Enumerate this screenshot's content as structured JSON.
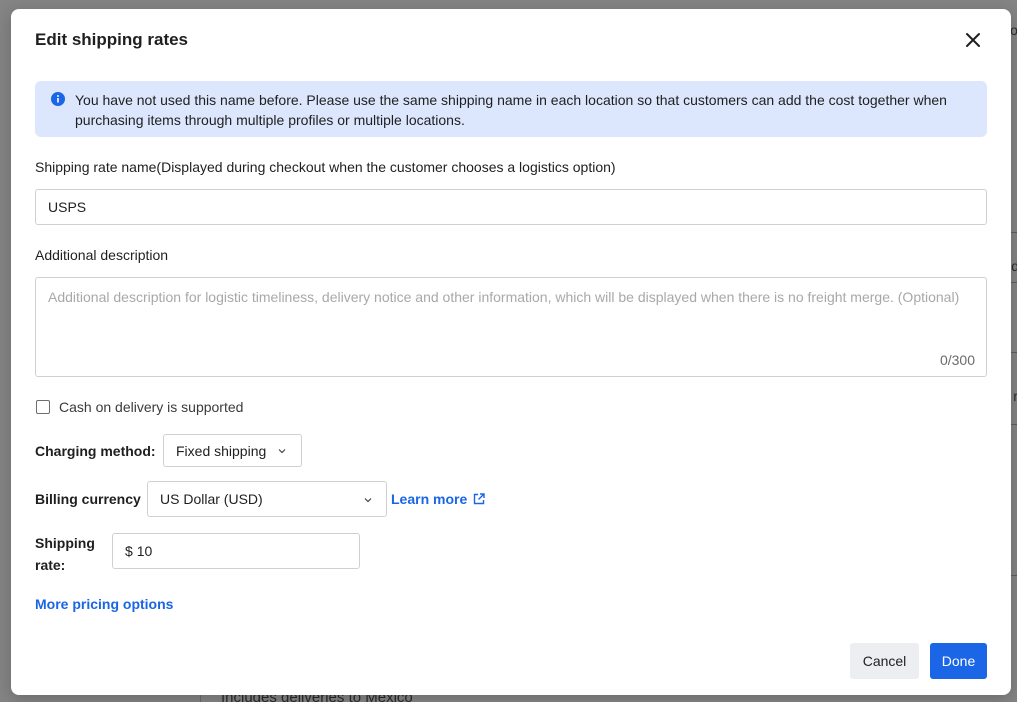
{
  "background": {
    "footer_text": "Includes deliveries to Mexico",
    "fragments": [
      "ol",
      "d",
      "n"
    ]
  },
  "modal": {
    "title": "Edit shipping rates",
    "info": "You have not used this name before. Please use the same shipping name in each location so that customers can add the cost together when purchasing items through multiple profiles or multiple locations.",
    "rate_name": {
      "label": "Shipping rate name",
      "hint": "(Displayed during checkout when the customer chooses a logistics option)",
      "value": "USPS"
    },
    "description": {
      "label": "Additional description",
      "placeholder": "Additional description for logistic timeliness, delivery notice and other information, which will be displayed when there is no freight merge. (Optional)",
      "count": "0/300"
    },
    "cod_label": "Cash on delivery is supported",
    "charging_method": {
      "label": "Charging method:",
      "value": "Fixed shipping"
    },
    "billing_currency": {
      "label": "Billing currency",
      "value": "US Dollar (USD)",
      "learn_more": "Learn more"
    },
    "shipping_rate": {
      "label_line1": "Shipping",
      "label_line2": "rate:",
      "currency_symbol": "$",
      "value": "10"
    },
    "more_pricing": "More pricing options",
    "buttons": {
      "cancel": "Cancel",
      "done": "Done"
    }
  },
  "colors": {
    "accent": "#1a66e6",
    "info_bg": "#dce7fd",
    "overlay": "#848484"
  }
}
